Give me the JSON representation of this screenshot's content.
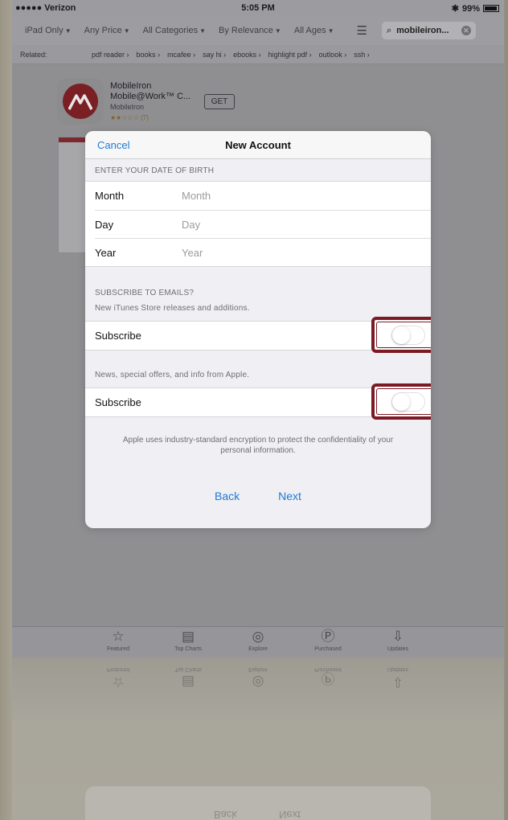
{
  "status_bar": {
    "carrier": "●●●●● Verizon",
    "time": "5:05 PM",
    "battery": "99%"
  },
  "filters": [
    {
      "label": "iPad Only"
    },
    {
      "label": "Any Price"
    },
    {
      "label": "All Categories"
    },
    {
      "label": "By Relevance"
    },
    {
      "label": "All Ages"
    }
  ],
  "search": {
    "value": "mobileiron..."
  },
  "related": {
    "label": "Related:",
    "items": [
      "pdf reader",
      "books",
      "mcafee",
      "say hi",
      "ebooks",
      "highlight pdf",
      "outlook",
      "ssh"
    ]
  },
  "app_result": {
    "name_line1": "MobileIron",
    "name_line2": "Mobile@Work™ C...",
    "publisher": "MobileIron",
    "rating": "★★☆☆☆ (7)",
    "get_label": "GET"
  },
  "modal": {
    "cancel": "Cancel",
    "title": "New Account",
    "dob_section": "ENTER YOUR DATE OF BIRTH",
    "dob_fields": [
      {
        "label": "Month",
        "placeholder": "Month"
      },
      {
        "label": "Day",
        "placeholder": "Day"
      },
      {
        "label": "Year",
        "placeholder": "Year"
      }
    ],
    "email_section": "SUBSCRIBE TO EMAILS?",
    "email_note_1": "New iTunes Store releases and additions.",
    "subscribe_1": "Subscribe",
    "email_note_2": "News, special offers, and info from Apple.",
    "subscribe_2": "Subscribe",
    "privacy_text": "Apple uses industry-standard encryption to protect the confidentiality of your personal information.",
    "back": "Back",
    "next": "Next"
  },
  "tabs": [
    {
      "label": "Featured",
      "icon": "star-icon"
    },
    {
      "label": "Top Charts",
      "icon": "list-icon"
    },
    {
      "label": "Explore",
      "icon": "compass-icon"
    },
    {
      "label": "Purchased",
      "icon": "purchased-icon"
    },
    {
      "label": "Updates",
      "icon": "updates-icon"
    }
  ],
  "reflection": {
    "back": "Back",
    "next": "Next"
  }
}
